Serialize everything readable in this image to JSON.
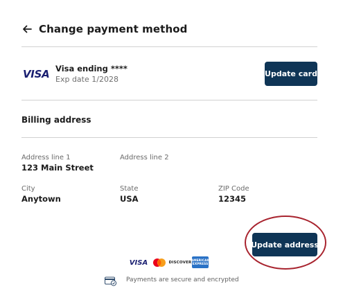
{
  "header": {
    "title": "Change payment method",
    "back_icon": "arrow-left-icon"
  },
  "card": {
    "brand_logo": "VISA",
    "title": "Visa ending ****",
    "expiry": "Exp date 1/2028",
    "update_button_label": "Update card"
  },
  "billing": {
    "heading": "Billing address",
    "fields": {
      "address_line_1": {
        "label": "Address line 1",
        "value": "123 Main Street"
      },
      "address_line_2": {
        "label": "Address line 2",
        "value": ""
      },
      "city": {
        "label": "City",
        "value": "Anytown"
      },
      "state": {
        "label": "State",
        "value": "USA"
      },
      "zip": {
        "label": "ZIP Code",
        "value": "12345"
      }
    },
    "update_button_label": "Update address"
  },
  "accepted_cards": {
    "visa": "VISA",
    "mastercard": "mastercard-logo",
    "discover": "DISCOVER",
    "amex_line1": "AMERICAN",
    "amex_line2": "EXPRESS"
  },
  "footer": {
    "secure_icon": "secure-card-icon",
    "secure_text": "Payments are secure and encrypted"
  },
  "colors": {
    "primary_button": "#0f3556",
    "highlight_ring": "#a8232e",
    "divider": "#d0d0d0",
    "visa_blue": "#1a1f71",
    "amex_blue": "#2a72c6"
  }
}
